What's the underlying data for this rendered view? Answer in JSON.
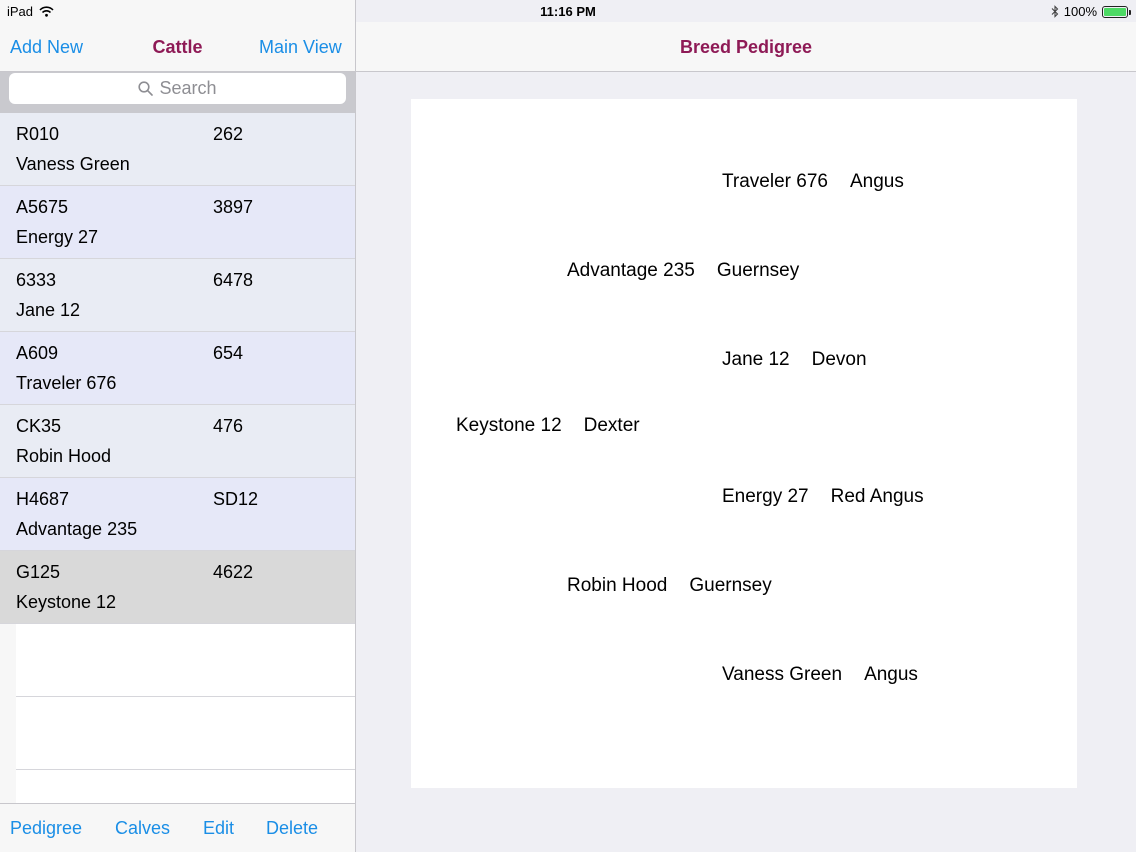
{
  "status": {
    "device": "iPad",
    "time": "11:16 PM",
    "battery": "100%",
    "battery_level": 1.0,
    "icons": [
      "wifi-icon",
      "bluetooth-icon",
      "battery-icon"
    ]
  },
  "master": {
    "add_label": "Add New",
    "title": "Cattle",
    "main_view_label": "Main View",
    "search_placeholder": "Search",
    "rows": [
      {
        "tag": "R010",
        "id": "262",
        "name": "Vaness Green"
      },
      {
        "tag": "A5675",
        "id": "3897",
        "name": "Energy 27"
      },
      {
        "tag": "6333",
        "id": "6478",
        "name": "Jane 12"
      },
      {
        "tag": "A609",
        "id": "654",
        "name": "Traveler 676"
      },
      {
        "tag": "CK35",
        "id": "476",
        "name": "Robin Hood"
      },
      {
        "tag": "H4687",
        "id": "SD12",
        "name": "Advantage 235"
      },
      {
        "tag": "G125",
        "id": "4622",
        "name": "Keystone 12"
      }
    ],
    "toolbar": {
      "pedigree": "Pedigree",
      "calves": "Calves",
      "edit": "Edit",
      "delete": "Delete"
    }
  },
  "detail": {
    "title": "Breed Pedigree",
    "pedigree": {
      "self": {
        "name": "Keystone 12",
        "breed": "Dexter"
      },
      "sire": {
        "name": "Advantage 235",
        "breed": "Guernsey"
      },
      "dam": {
        "name": "Robin Hood",
        "breed": "Guernsey"
      },
      "sire_sire": {
        "name": "Traveler 676",
        "breed": "Angus"
      },
      "sire_dam": {
        "name": "Jane 12",
        "breed": "Devon"
      },
      "dam_sire": {
        "name": "Energy 27",
        "breed": "Red Angus"
      },
      "dam_dam": {
        "name": "Vaness Green",
        "breed": "Angus"
      }
    }
  },
  "colors": {
    "accent": "#1a8ee6",
    "title": "#8e1a56",
    "row_highlight": "#e6e8f8",
    "row_alt": "#e9ecf4",
    "row_selected": "#d9d9d9"
  }
}
